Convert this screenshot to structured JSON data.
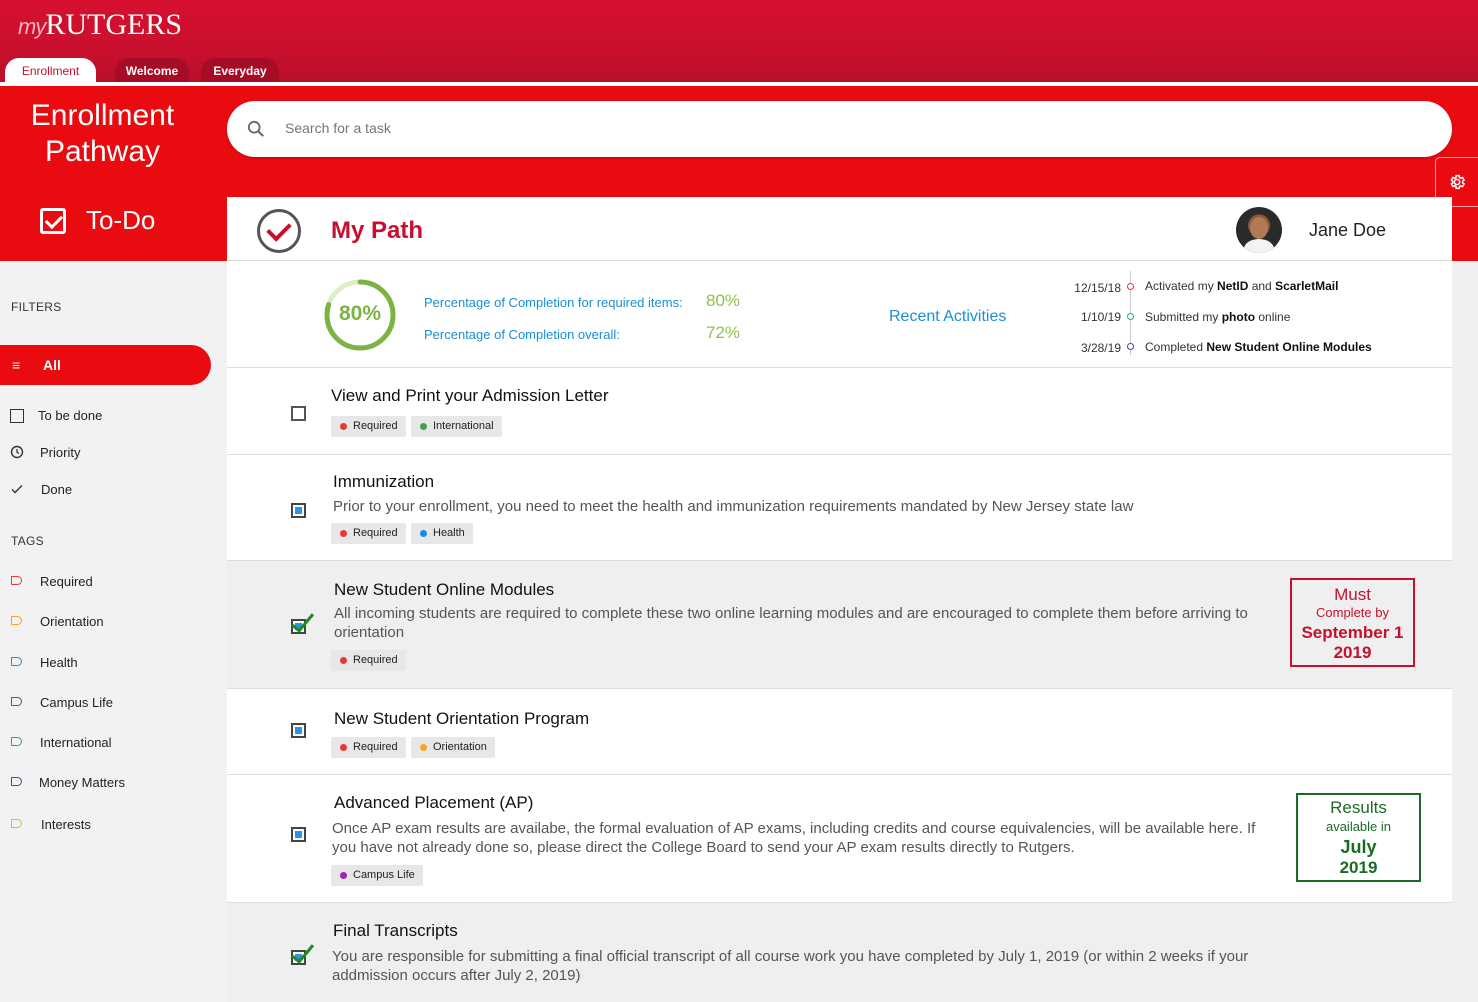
{
  "brand": {
    "my": "my",
    "name": "RUTGERS"
  },
  "tabs": [
    {
      "label": "Enrollment"
    },
    {
      "label": "Welcome"
    },
    {
      "label": "Everyday"
    }
  ],
  "header": {
    "title_line1": "Enrollment",
    "title_line2": "Pathway",
    "todo_label": "To-Do"
  },
  "search": {
    "placeholder": "Search for a task"
  },
  "sidebar": {
    "filters_label": "FILTERS",
    "all_label": "All",
    "filters": [
      {
        "label": "To be done",
        "icon": "empty-checkbox-icon"
      },
      {
        "label": "Priority",
        "icon": "clock-icon"
      },
      {
        "label": "Done",
        "icon": "checkmark-icon"
      }
    ],
    "tags_label": "TAGS",
    "tags": [
      {
        "label": "Required",
        "color": "#e53935"
      },
      {
        "label": "Orientation",
        "color": "#f5a623"
      },
      {
        "label": "Health",
        "color": "#1e88e5"
      },
      {
        "label": "Campus Life",
        "color": "#9c27b0"
      },
      {
        "label": "International",
        "color": "#43a047"
      },
      {
        "label": "Money Matters",
        "color": "#3949ab"
      },
      {
        "label": "Interests",
        "color": "#c0ca33"
      }
    ]
  },
  "card": {
    "title": "My Path",
    "user_name": "Jane Doe",
    "completion_ring": "80%",
    "completion_fraction": 0.8,
    "required_label": "Percentage of Completion for required items:",
    "required_value": "80%",
    "overall_label": "Percentage of Completion overall:",
    "overall_value": "72%",
    "recent_label": "Recent Activities",
    "activities": [
      {
        "date": "12/15/18",
        "pre": "Activated my ",
        "b1": "NetID",
        "mid": " and ",
        "b2": "ScarletMail",
        "color": "#e53935"
      },
      {
        "date": "1/10/19",
        "pre": "Submitted my ",
        "b1": "photo",
        "mid": " online",
        "b2": "",
        "color": "#26a69a"
      },
      {
        "date": "3/28/19",
        "pre": "Completed ",
        "b1": "New Student Online Modules",
        "mid": "",
        "b2": "",
        "color": "#5e35b1"
      }
    ]
  },
  "tasks": [
    {
      "title": "View and Print your Admission Letter",
      "desc": "",
      "tags": [
        {
          "label": "Required",
          "color": "#e53935"
        },
        {
          "label": "International",
          "color": "#43a047"
        }
      ]
    },
    {
      "title": "Immunization",
      "desc": "Prior to your enrollment, you need to meet the health and immunization requirements mandated by New Jersey state law",
      "tags": [
        {
          "label": "Required",
          "color": "#e53935"
        },
        {
          "label": "Health",
          "color": "#1e88e5"
        }
      ]
    },
    {
      "title": "New Student Online Modules",
      "desc": "All incoming students are required to complete these two online learning modules and are encouraged to complete them before arriving to orientation",
      "tags": [
        {
          "label": "Required",
          "color": "#e53935"
        }
      ],
      "note": {
        "l1": "Must",
        "l2": "Complete by",
        "l3": "September 1",
        "l4": "2019"
      }
    },
    {
      "title": "New Student Orientation Program",
      "desc": "",
      "tags": [
        {
          "label": "Required",
          "color": "#e53935"
        },
        {
          "label": "Orientation",
          "color": "#f5a623"
        }
      ]
    },
    {
      "title": "Advanced Placement (AP)",
      "desc": "Once AP exam results are availabe, the formal evaluation of AP exams, including credits and course equivalencies, will be available here. If you have not already done so, please direct the College Board to send your AP exam results directly to Rutgers.",
      "tags": [
        {
          "label": "Campus Life",
          "color": "#9c27b0"
        }
      ],
      "note": {
        "l1": "Results",
        "l2": "available in",
        "l3": "July",
        "l4": "2019"
      }
    },
    {
      "title": "Final Transcripts",
      "desc": "You are responsible for submitting a final official transcript of all course work you have completed by July 1, 2019 (or within 2 weeks if your addmission occurs after July 2, 2019)",
      "tags": []
    }
  ]
}
